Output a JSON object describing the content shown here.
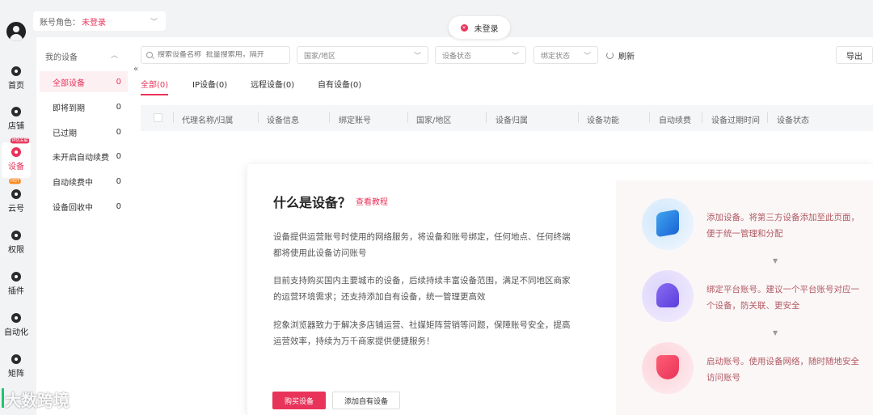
{
  "header": {
    "role_label": "账号角色：",
    "role_value": "未登录",
    "toast_text": "未登录"
  },
  "rail": {
    "items": [
      {
        "label": "首页",
        "icon": "home-icon"
      },
      {
        "label": "店铺",
        "icon": "shop-icon"
      },
      {
        "label": "设备",
        "icon": "device-icon",
        "badge": "IP防关联"
      },
      {
        "label": "云号",
        "icon": "cloud-icon",
        "badge": "HOT"
      },
      {
        "label": "权限",
        "icon": "permission-icon"
      },
      {
        "label": "插件",
        "icon": "plugin-icon"
      },
      {
        "label": "自动化",
        "icon": "automation-icon"
      },
      {
        "label": "矩阵",
        "icon": "matrix-icon"
      }
    ]
  },
  "sidepanel": {
    "title": "我的设备",
    "items": [
      {
        "label": "全部设备",
        "count": "0"
      },
      {
        "label": "即将到期",
        "count": "0"
      },
      {
        "label": "已过期",
        "count": "0"
      },
      {
        "label": "未开启自动续费",
        "count": "0"
      },
      {
        "label": "自动续费中",
        "count": "0"
      },
      {
        "label": "设备回收中",
        "count": "0"
      }
    ]
  },
  "toolbar": {
    "search_placeholder": "搜索设备名称  批量搜索用，隔开",
    "country_placeholder": "国家/地区",
    "status_placeholder": "设备状态",
    "bind_placeholder": "绑定状态",
    "refresh_label": "刷新",
    "export_label": "导出"
  },
  "tabs": [
    "全部(0)",
    "IP设备(0)",
    "远程设备(0)",
    "自有设备(0)"
  ],
  "table": {
    "columns": [
      "代理名称/归属",
      "设备信息",
      "绑定账号",
      "国家/地区",
      "设备归属",
      "设备功能",
      "自动续费",
      "设备过期时间",
      "设备状态"
    ]
  },
  "intro": {
    "title": "什么是设备？",
    "link": "查看教程",
    "paragraphs": [
      "设备提供运营账号时使用的网络服务，将设备和账号绑定，任何地点、任何终端都将使用此设备访问账号",
      "目前支持购买国内主要城市的设备，后续持续丰富设备范围，满足不同地区商家的运营环境需求；还支持添加自有设备，统一管理更高效",
      "挖象浏览器致力于解决多店铺运营、社媒矩阵营销等问题，保障账号安全，提高运营效率，持续为万千商家提供便捷服务！"
    ],
    "buy_button": "购买设备",
    "add_button": "添加自有设备",
    "steps": [
      "添加设备。将第三方设备添加至此页面，便于统一管理和分配",
      "绑定平台账号。建议一个平台账号对应一个设备，防关联、更安全",
      "启动账号。使用设备网络，随时随地安全访问账号"
    ],
    "step_arrow": "▼"
  },
  "watermark": "大数跨境"
}
